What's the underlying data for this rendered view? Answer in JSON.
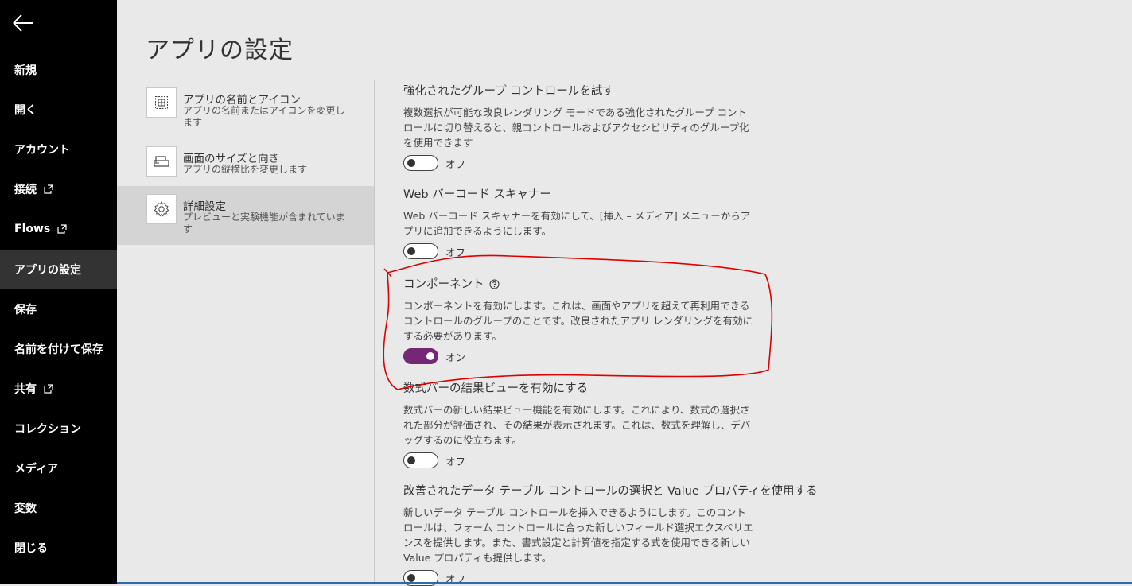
{
  "nav": {
    "items": [
      {
        "label": "新規"
      },
      {
        "label": "開く"
      },
      {
        "label": "アカウント"
      },
      {
        "label": "接続"
      },
      {
        "label": "Flows"
      },
      {
        "label": "アプリの設定"
      },
      {
        "label": "保存"
      },
      {
        "label": "名前を付けて保存"
      },
      {
        "label": "共有"
      },
      {
        "label": "コレクション"
      },
      {
        "label": "メディア"
      },
      {
        "label": "変数"
      },
      {
        "label": "閉じる"
      }
    ],
    "active": "アプリの設定"
  },
  "page": {
    "title": "アプリの設定"
  },
  "categories": [
    {
      "title": "アプリの名前とアイコン",
      "desc": "アプリの名前またはアイコンを変更します",
      "icon": "app-grid-icon"
    },
    {
      "title": "画面のサイズと向き",
      "desc": "アプリの縦横比を変更します",
      "icon": "screen-size-icon"
    },
    {
      "title": "詳細設定",
      "desc": "プレビューと実験機能が含まれています",
      "icon": "gear-icon"
    }
  ],
  "settings": [
    {
      "title": "強化されたグループ コントロールを試す",
      "desc": "複数選択が可能な改良レンダリング モードである強化されたグループ コントロールに切り替えると、親コントロールおよびアクセシビリティのグループ化を使用できます",
      "state": "オフ"
    },
    {
      "title": "Web バーコード スキャナー",
      "desc": "Web バーコード スキャナーを有効にして、[挿入 – メディア] メニューからアプリに追加できるようにします。",
      "state": "オフ"
    },
    {
      "title": "コンポーネント",
      "desc": "コンポーネントを有効にします。これは、画面やアプリを超えて再利用できるコントロールのグループのことです。改良されたアプリ レンダリングを有効にする必要があります。",
      "state": "オン"
    },
    {
      "title": "数式バーの結果ビューを有効にする",
      "desc": "数式バーの新しい結果ビュー機能を有効にします。これにより、数式の選択された部分が評価され、その結果が表示されます。これは、数式を理解し、デバッグするのに役立ちます。",
      "state": "オフ"
    },
    {
      "title": "改善されたデータ テーブル コントロールの選択と Value プロパティを使用する",
      "desc": "新しいデータ テーブル コントロールを挿入できるようにします。このコントロールは、フォーム コントロールに合った新しいフィールド選択エクスペリエンスを提供します。また、書式設定と計算値を指定する式を使用できる新しい Value プロパティも提供します。",
      "state": "オフ"
    }
  ],
  "colors": {
    "nav_bg": "#000000",
    "toggle_on": "#742774",
    "annotation": "#e00000"
  }
}
